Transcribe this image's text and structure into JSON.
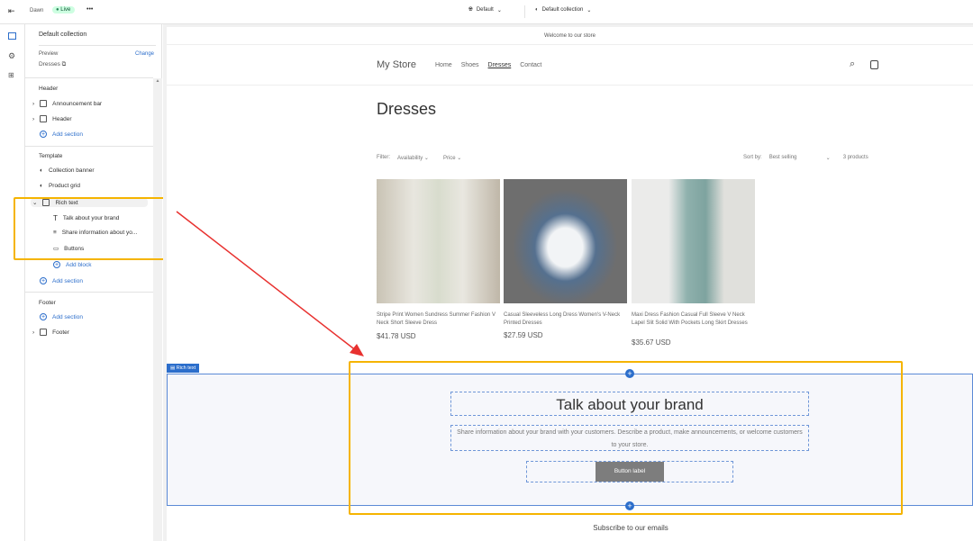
{
  "topbar": {
    "theme": "Dawn",
    "status": "Live",
    "more": "•••",
    "language": "Default",
    "template": "Default collection"
  },
  "sidebar": {
    "title": "Default collection",
    "preview_label": "Preview",
    "change": "Change",
    "preview_value": "Dresses",
    "header_label": "Header",
    "header_items": [
      "Announcement bar",
      "Header"
    ],
    "add_section": "Add section",
    "template_label": "Template",
    "template_items": [
      "Collection banner",
      "Product grid",
      "Rich text"
    ],
    "rich_text_blocks": [
      "Talk about your brand",
      "Share information about yo...",
      "Buttons"
    ],
    "add_block": "Add block",
    "footer_label": "Footer",
    "footer_item": "Footer"
  },
  "store": {
    "announcement": "Welcome to our store",
    "name": "My Store",
    "nav": [
      "Home",
      "Shoes",
      "Dresses",
      "Contact"
    ],
    "page_title": "Dresses",
    "filter_label": "Filter:",
    "filters": [
      "Availability",
      "Price"
    ],
    "sort_label": "Sort by:",
    "sort_value": "Best selling",
    "count": "3 products",
    "products": [
      {
        "title": "Stripe Print Women Sundress Summer Fashion V Neck Short Sleeve Dress",
        "price": "$41.78 USD"
      },
      {
        "title": "Casual Sleeveless Long Dress Women's V-Neck Printed Dresses",
        "price": "$27.59 USD"
      },
      {
        "title": "Maxi Dress Fashion Casual Full Sleeve V Neck Lapel Slit Solid With Pockets Long Skirt Dresses",
        "price": "$35.67 USD"
      }
    ],
    "rich_text_tag": "Rich text",
    "heading": "Talk about your brand",
    "text": "Share information about your brand with your customers. Describe a product, make announcements, or welcome customers to your store.",
    "button": "Button label",
    "subscribe": "Subscribe to our emails"
  },
  "colors": {
    "accent": "#2c6ecb",
    "highlight": "#f5b400",
    "arrow": "#e8312f"
  }
}
